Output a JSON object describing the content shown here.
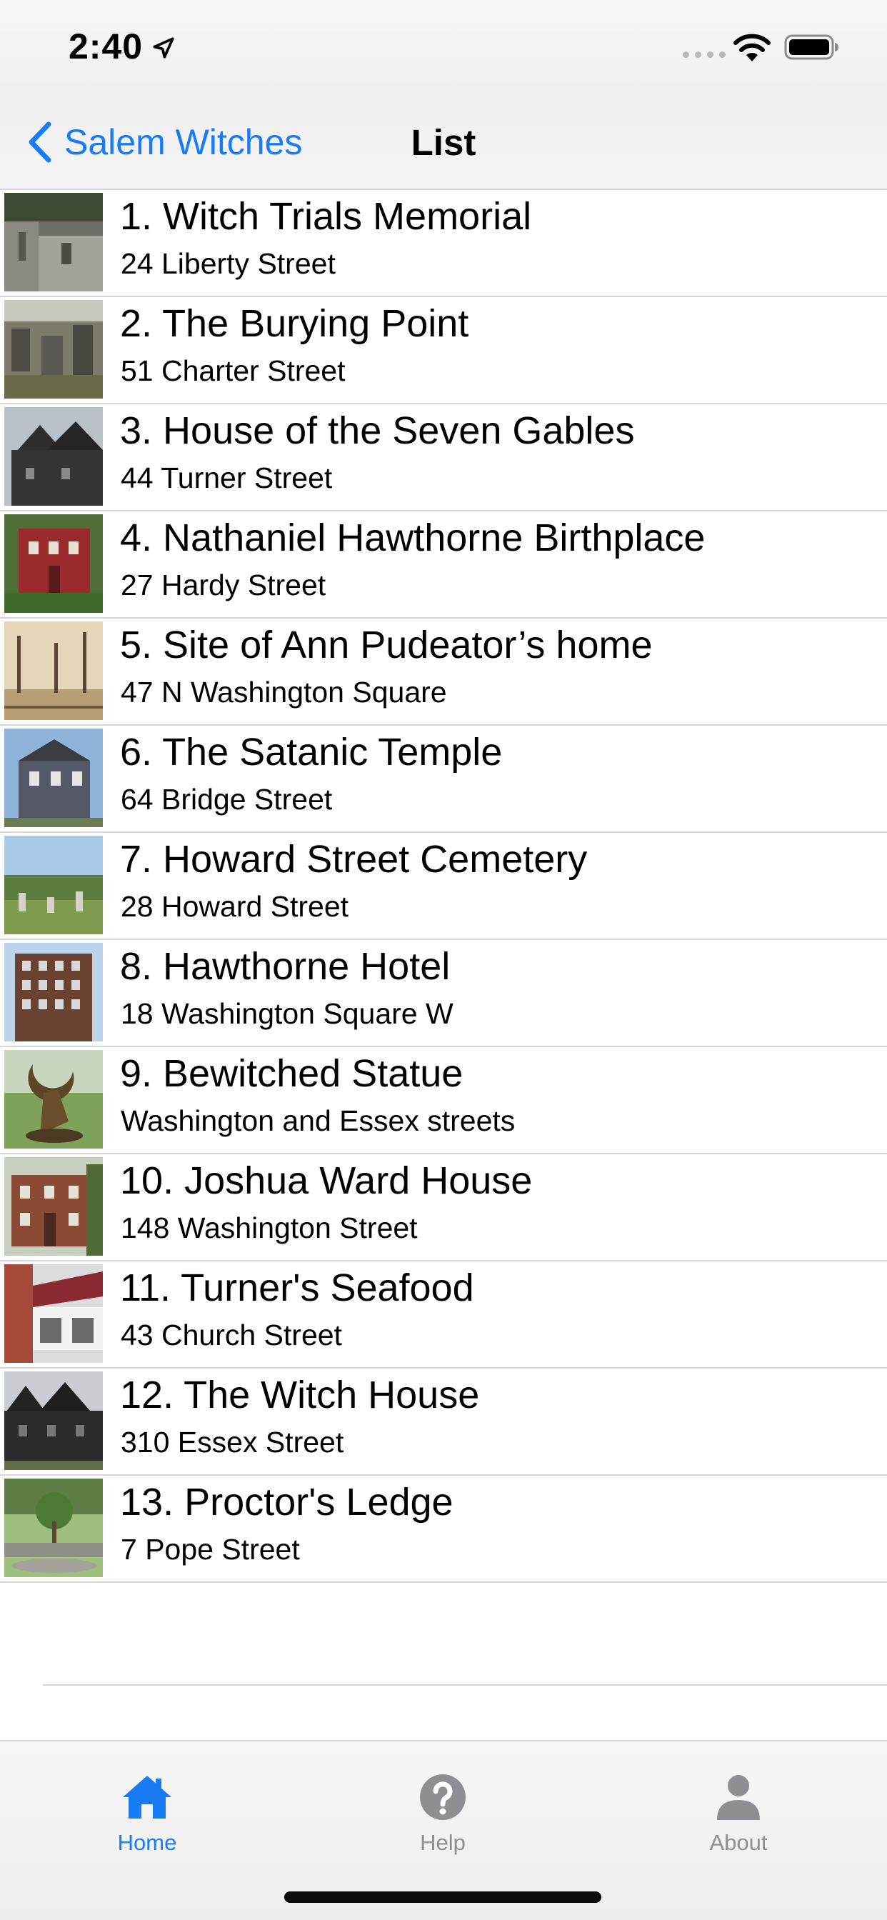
{
  "status_bar": {
    "time": "2:40"
  },
  "nav": {
    "back_label": "Salem Witches",
    "title": "List"
  },
  "items": [
    {
      "title": "1. Witch Trials Memorial",
      "address": "24 Liberty Street"
    },
    {
      "title": "2. The Burying Point",
      "address": "51 Charter Street"
    },
    {
      "title": "3. House of the Seven Gables",
      "address": "44 Turner Street"
    },
    {
      "title": "4. Nathaniel Hawthorne Birthplace",
      "address": "27 Hardy Street"
    },
    {
      "title": "5. Site of Ann Pudeator’s home",
      "address": "47 N Washington Square"
    },
    {
      "title": "6. The Satanic Temple",
      "address": "64 Bridge Street"
    },
    {
      "title": "7. Howard Street Cemetery",
      "address": "28 Howard Street"
    },
    {
      "title": "8. Hawthorne Hotel",
      "address": "18 Washington Square W"
    },
    {
      "title": "9. Bewitched Statue",
      "address": "Washington and Essex streets"
    },
    {
      "title": "10. Joshua Ward House",
      "address": "148 Washington Street"
    },
    {
      "title": "11. Turner's Seafood",
      "address": "43 Church Street"
    },
    {
      "title": "12. The Witch House",
      "address": "310 Essex Street"
    },
    {
      "title": "13. Proctor's Ledge",
      "address": "7 Pope Street"
    }
  ],
  "tabs": [
    {
      "label": "Home",
      "icon": "house-icon",
      "active": true
    },
    {
      "label": "Help",
      "icon": "question-circle-icon",
      "active": false
    },
    {
      "label": "About",
      "icon": "person-icon",
      "active": false
    }
  ],
  "colors": {
    "accent": "#1a7cf5",
    "inactive_tab": "#8e8e93",
    "separator": "#d6d6d6"
  }
}
